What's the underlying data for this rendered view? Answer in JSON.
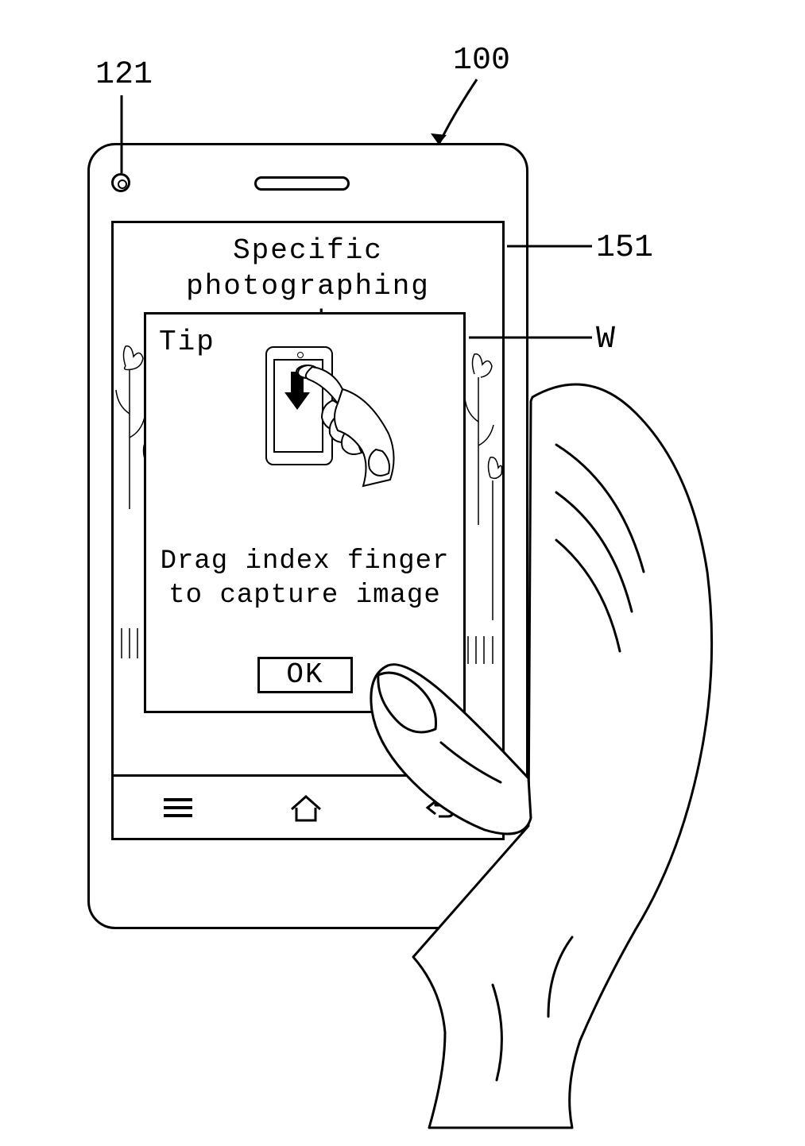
{
  "callouts": {
    "device": "100",
    "camera": "121",
    "display": "151",
    "window": "W"
  },
  "screen": {
    "mode_title_line1": "Specific photographing",
    "mode_title_line2": "mode"
  },
  "tip": {
    "header": "Tip",
    "instruction_line1": "Drag index finger",
    "instruction_line2": "to capture image",
    "ok_label": "OK"
  },
  "navbar": {
    "menu": "menu-icon",
    "home": "home-icon",
    "back": "back-icon"
  }
}
